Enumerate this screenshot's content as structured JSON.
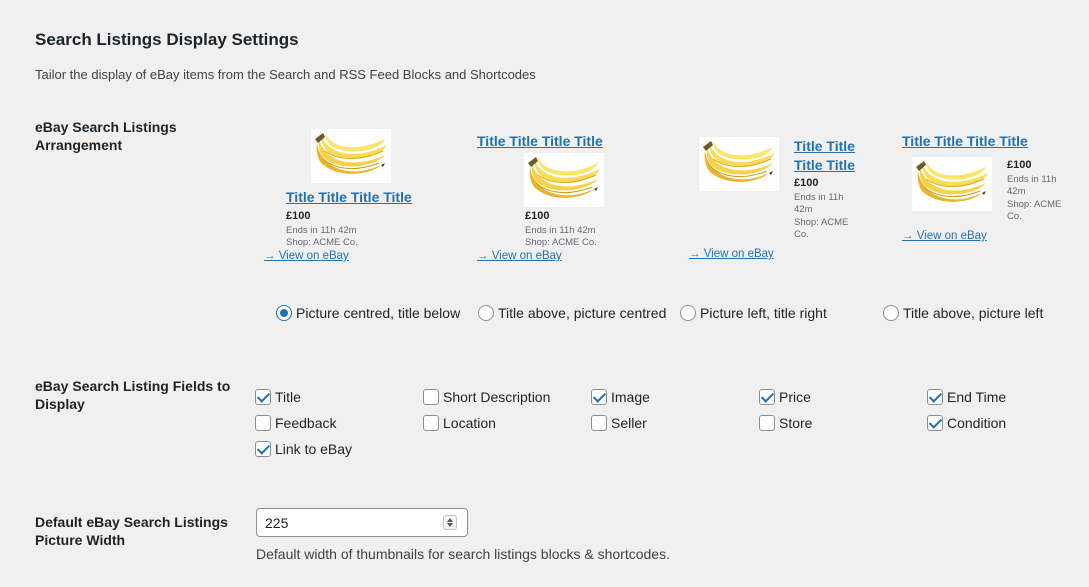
{
  "section": {
    "title": "Search Listings Display Settings",
    "description": "Tailor the display of eBay items from the Search and RSS Feed Blocks and Shortcodes"
  },
  "arrangement": {
    "label": "eBay Search Listings Arrangement",
    "previews": [
      {
        "title": "Title Title Title Title",
        "title_lines": [
          "Title Title Title Title"
        ],
        "price": "£100",
        "ends": "Ends in 11h 42m",
        "shop": "Shop: ACME Co.",
        "view_link": "→ View on eBay"
      },
      {
        "title": "Title Title Title Title",
        "title_lines": [
          "Title Title Title Title"
        ],
        "price": "£100",
        "ends": "Ends in 11h 42m",
        "shop": "Shop: ACME Co.",
        "view_link": "→ View on eBay"
      },
      {
        "title": "Title Title Title Title",
        "title_lines": [
          "Title Title",
          "Title Title"
        ],
        "price": "£100",
        "ends_lines": [
          "Ends in 11h",
          "42m"
        ],
        "shop_lines": [
          "Shop: ACME",
          "Co."
        ],
        "view_link": "→ View on eBay"
      },
      {
        "title": "Title Title Title Title",
        "title_lines": [
          "Title Title Title Title"
        ],
        "price": "£100",
        "ends_lines": [
          "Ends in 11h",
          "42m"
        ],
        "shop_lines": [
          "Shop: ACME",
          "Co."
        ],
        "view_link": "→ View on eBay"
      }
    ],
    "options": [
      {
        "label": "Picture centred, title below",
        "checked": true
      },
      {
        "label": "Title above, picture centred",
        "checked": false
      },
      {
        "label": "Picture left, title right",
        "checked": false
      },
      {
        "label": "Title above, picture left",
        "checked": false
      }
    ]
  },
  "fields": {
    "label": "eBay Search Listing Fields to Display",
    "options": [
      {
        "label": "Title",
        "checked": true
      },
      {
        "label": "Short Description",
        "checked": false
      },
      {
        "label": "Image",
        "checked": true
      },
      {
        "label": "Price",
        "checked": true
      },
      {
        "label": "End Time",
        "checked": true
      },
      {
        "label": "Feedback",
        "checked": false
      },
      {
        "label": "Location",
        "checked": false
      },
      {
        "label": "Seller",
        "checked": false
      },
      {
        "label": "Store",
        "checked": false
      },
      {
        "label": "Condition",
        "checked": true
      },
      {
        "label": "Link to eBay",
        "checked": true
      }
    ]
  },
  "picture_width": {
    "label": "Default eBay Search Listings Picture Width",
    "value": "225",
    "help": "Default width of thumbnails for search listings blocks & shortcodes."
  },
  "colors": {
    "accent": "#2271b1",
    "background": "#f0f0f1",
    "text": "#1d2327"
  }
}
